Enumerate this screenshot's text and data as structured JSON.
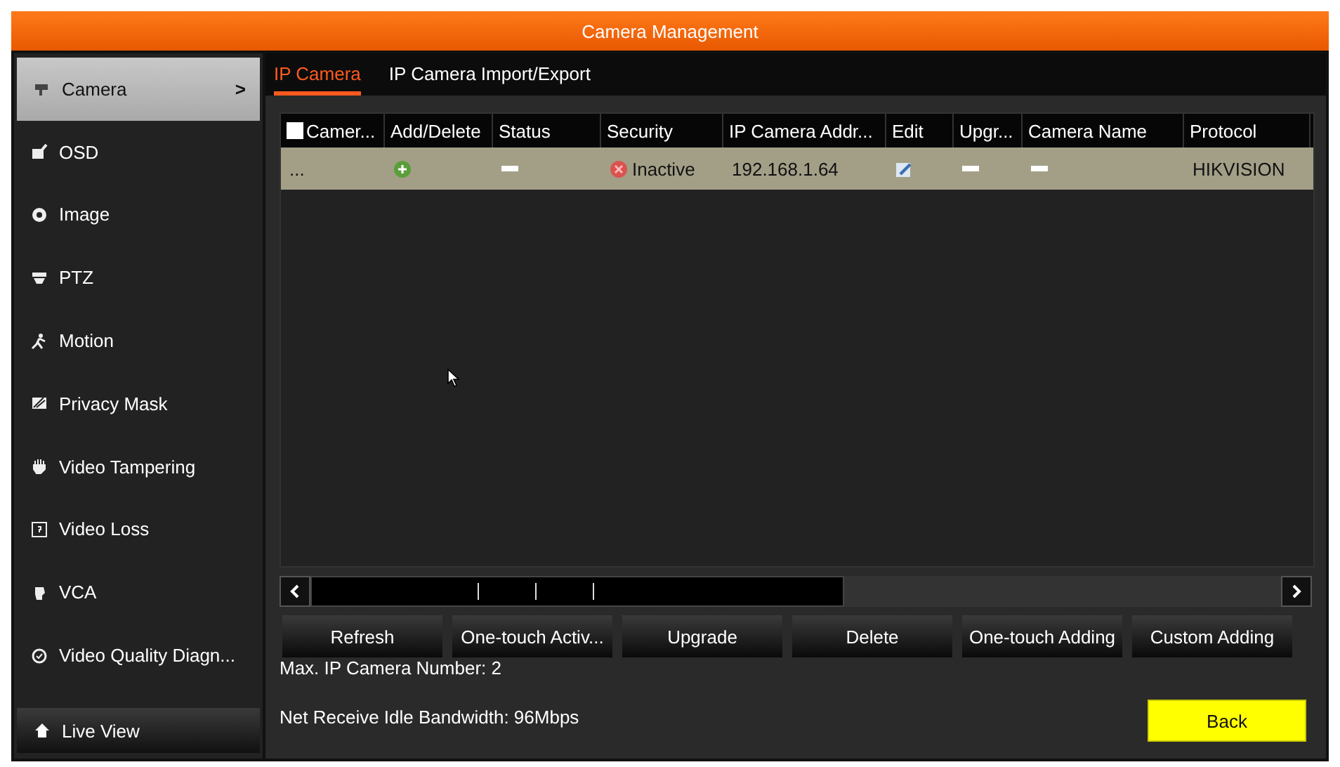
{
  "window": {
    "title": "Camera Management"
  },
  "sidebar": {
    "items": [
      {
        "label": "Camera",
        "selected": true,
        "arrow": ">"
      },
      {
        "label": "OSD",
        "selected": false
      },
      {
        "label": "Image",
        "selected": false
      },
      {
        "label": "PTZ",
        "selected": false
      },
      {
        "label": "Motion",
        "selected": false
      },
      {
        "label": "Privacy Mask",
        "selected": false
      },
      {
        "label": "Video Tampering",
        "selected": false
      },
      {
        "label": "Video Loss",
        "selected": false
      },
      {
        "label": "VCA",
        "selected": false
      },
      {
        "label": "Video Quality Diagn...",
        "selected": false
      }
    ],
    "footer": "Live View"
  },
  "tabs": [
    {
      "label": "IP Camera",
      "selected": true
    },
    {
      "label": "IP Camera Import/Export",
      "selected": false
    }
  ],
  "table": {
    "select_all": {
      "checked": false
    },
    "columns": [
      "Camer...",
      "Add/Delete",
      "Status",
      "Security",
      "IP Camera Addr...",
      "Edit",
      "Upgr...",
      "Camera Name",
      "Protocol"
    ],
    "rows": [
      {
        "selected": true,
        "cells": [
          {
            "kind": "text",
            "text": "..."
          },
          {
            "kind": "add"
          },
          {
            "kind": "dash"
          },
          {
            "kind": "status",
            "text": "Inactive"
          },
          {
            "kind": "text",
            "text": "192.168.1.64"
          },
          {
            "kind": "edit"
          },
          {
            "kind": "dash"
          },
          {
            "kind": "dash"
          },
          {
            "kind": "text",
            "text": "HIKVISION"
          }
        ]
      }
    ]
  },
  "buttons": [
    "Refresh",
    "One-touch Activ...",
    "Upgrade",
    "Delete",
    "One-touch Adding",
    "Custom Adding"
  ],
  "info": [
    "Max. IP Camera Number: 2",
    "Net Receive Idle Bandwidth: 96Mbps"
  ],
  "back_button": "Back"
}
